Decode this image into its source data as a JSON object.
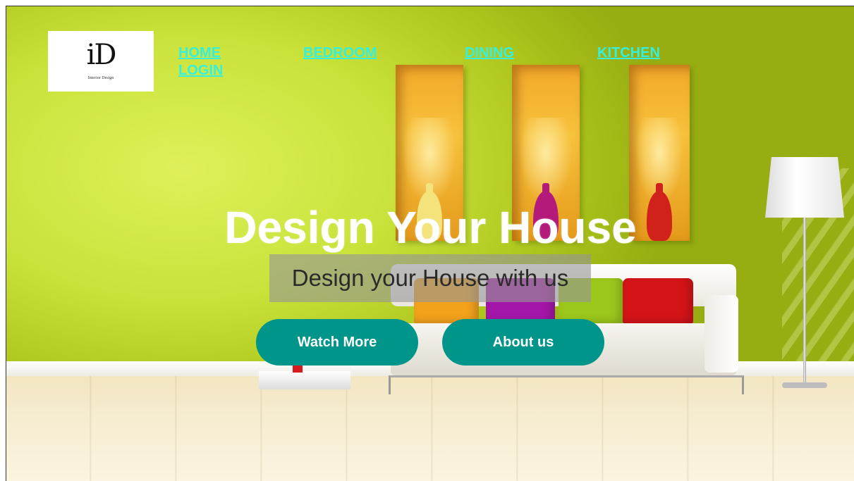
{
  "brand": {
    "logo_mark": "iD",
    "logo_sub": "Interior Design"
  },
  "nav": {
    "home": "HOME",
    "login": "LOGIN",
    "bedroom": "BEDROOM",
    "dining": "DINING",
    "kitchen": "KITCHEN"
  },
  "hero": {
    "title": "Design Your House",
    "subtitle": "Design your House with us"
  },
  "buttons": {
    "watch_more": "Watch More",
    "about_us": "About us"
  },
  "colors": {
    "nav_link": "#35f0dc",
    "button_bg": "#00958a",
    "wall": "#c9e23a"
  }
}
